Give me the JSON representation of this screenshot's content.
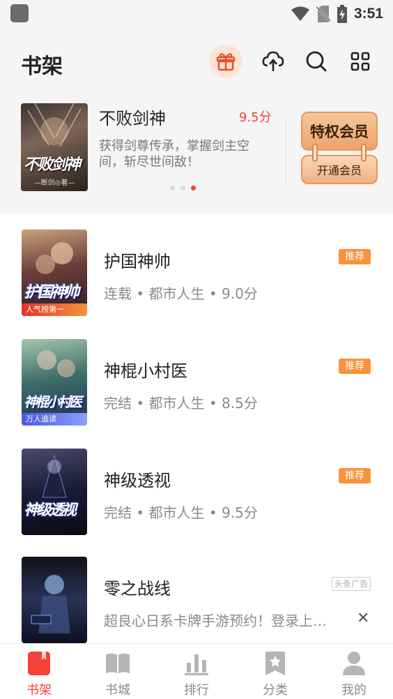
{
  "status_bar": {
    "time": "3:51"
  },
  "header": {
    "title": "书架"
  },
  "featured": {
    "title": "不败剑神",
    "score": "9.5分",
    "description": "获得剑尊传承，掌握剑主空间，斩尽世间敌！",
    "cover_title": "不败剑神",
    "cover_author": "—断剑◎著—"
  },
  "vip": {
    "title": "特权会员",
    "action": "开通会员"
  },
  "books": [
    {
      "title": "护国神帅",
      "meta": "连载 • 都市人生 • 9.0分",
      "badge": "推荐",
      "cover_title": "护国神帅",
      "cover_badge": "人气榜第一"
    },
    {
      "title": "神棍小村医",
      "meta": "完结 • 都市人生 • 8.5分",
      "badge": "推荐",
      "cover_title": "神棍小村医",
      "cover_badge": "万人追读"
    },
    {
      "title": "神级透视",
      "meta": "完结 • 都市人生 • 9.5分",
      "badge": "推荐",
      "cover_title": "神级透视",
      "cover_badge": ""
    }
  ],
  "ad": {
    "title": "零之战线",
    "description": "超良心日系卡牌手游预约！登录上…",
    "badge": "头条广告",
    "close": "✕"
  },
  "nav": [
    {
      "label": "书架",
      "icon": "bookshelf-icon",
      "active": true
    },
    {
      "label": "书城",
      "icon": "book-open-icon",
      "active": false
    },
    {
      "label": "排行",
      "icon": "ranking-icon",
      "active": false
    },
    {
      "label": "分类",
      "icon": "category-icon",
      "active": false
    },
    {
      "label": "我的",
      "icon": "profile-icon",
      "active": false
    }
  ],
  "colors": {
    "accent": "#f44336",
    "badge": "#f7933b",
    "vip": "#eda36b"
  }
}
